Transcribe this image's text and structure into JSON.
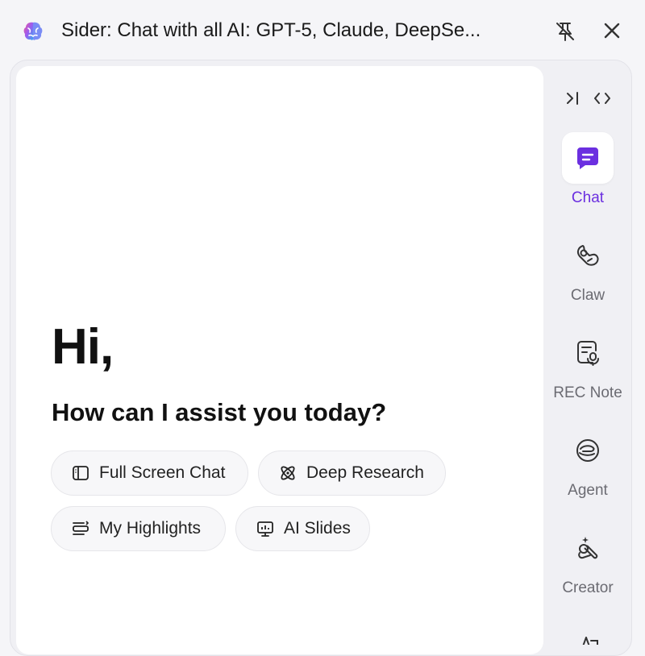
{
  "window": {
    "title": "Sider: Chat with all AI: GPT-5, Claude, DeepSe...",
    "app_icon": "brain-icon",
    "pin_icon": "unpin-icon",
    "close_icon": "close-icon"
  },
  "main": {
    "greeting": "Hi,",
    "subtitle": "How can I assist you today?",
    "chips": [
      {
        "label": "Full Screen Chat",
        "icon": "sidebar-layout-icon"
      },
      {
        "label": "Deep Research",
        "icon": "atom-icon"
      },
      {
        "label": "My Highlights",
        "icon": "highlight-list-icon"
      },
      {
        "label": "AI Slides",
        "icon": "presentation-icon"
      }
    ]
  },
  "rail": {
    "top_icons": [
      "collapse-icon",
      "code-icon"
    ],
    "items": [
      {
        "label": "Chat",
        "icon": "chat-icon",
        "active": true
      },
      {
        "label": "Claw",
        "icon": "claw-icon",
        "active": false
      },
      {
        "label": "REC Note",
        "icon": "rec-note-icon",
        "active": false
      },
      {
        "label": "Agent",
        "icon": "agent-icon",
        "active": false
      },
      {
        "label": "Creator",
        "icon": "creator-icon",
        "active": false
      }
    ]
  },
  "colors": {
    "accent": "#6b2fe0",
    "background": "#f5f5f8",
    "panel": "#ffffff"
  }
}
